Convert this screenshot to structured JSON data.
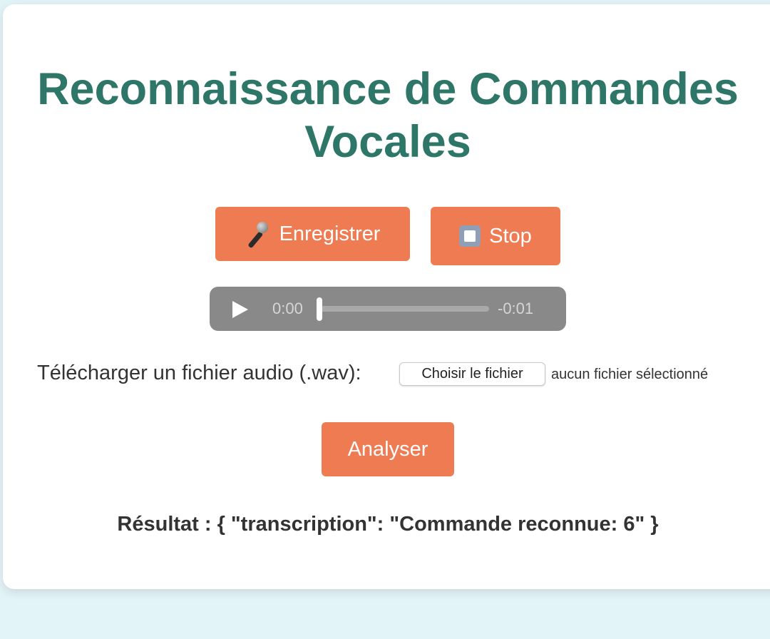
{
  "page": {
    "title_line1": "Reconnaissance de Commandes",
    "title_line2": "Vocales"
  },
  "controls": {
    "record_label": "Enregistrer",
    "stop_label": "Stop",
    "analyze_label": "Analyser",
    "record_icon": "microphone-icon",
    "stop_icon": "stop-square-icon"
  },
  "audio": {
    "current_time": "0:00",
    "remaining_time": "-0:01",
    "progress": 0
  },
  "upload": {
    "label": "Télécharger un fichier audio (.wav):",
    "button_label": "Choisir le fichier",
    "status": "aucun fichier sélectionné"
  },
  "result": {
    "text": "Résultat : { \"transcription\": \"Commande reconnue: 6\" }"
  },
  "colors": {
    "background": "#e3f4f8",
    "title": "#2e7768",
    "button": "#ef7b52",
    "player": "#898989"
  }
}
